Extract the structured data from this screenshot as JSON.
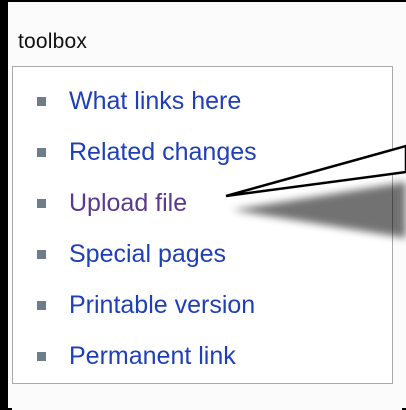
{
  "toolbox": {
    "title": "toolbox",
    "items": [
      {
        "label": "What links here",
        "visited": false
      },
      {
        "label": "Related changes",
        "visited": false
      },
      {
        "label": "Upload file",
        "visited": true
      },
      {
        "label": "Special pages",
        "visited": false
      },
      {
        "label": "Printable version",
        "visited": false
      },
      {
        "label": "Permanent link",
        "visited": false
      }
    ]
  },
  "colors": {
    "link": "#1f3fb8",
    "visited_link": "#5a3a8e",
    "bullet": "#6e7d8a",
    "border": "#a9a9a9"
  }
}
